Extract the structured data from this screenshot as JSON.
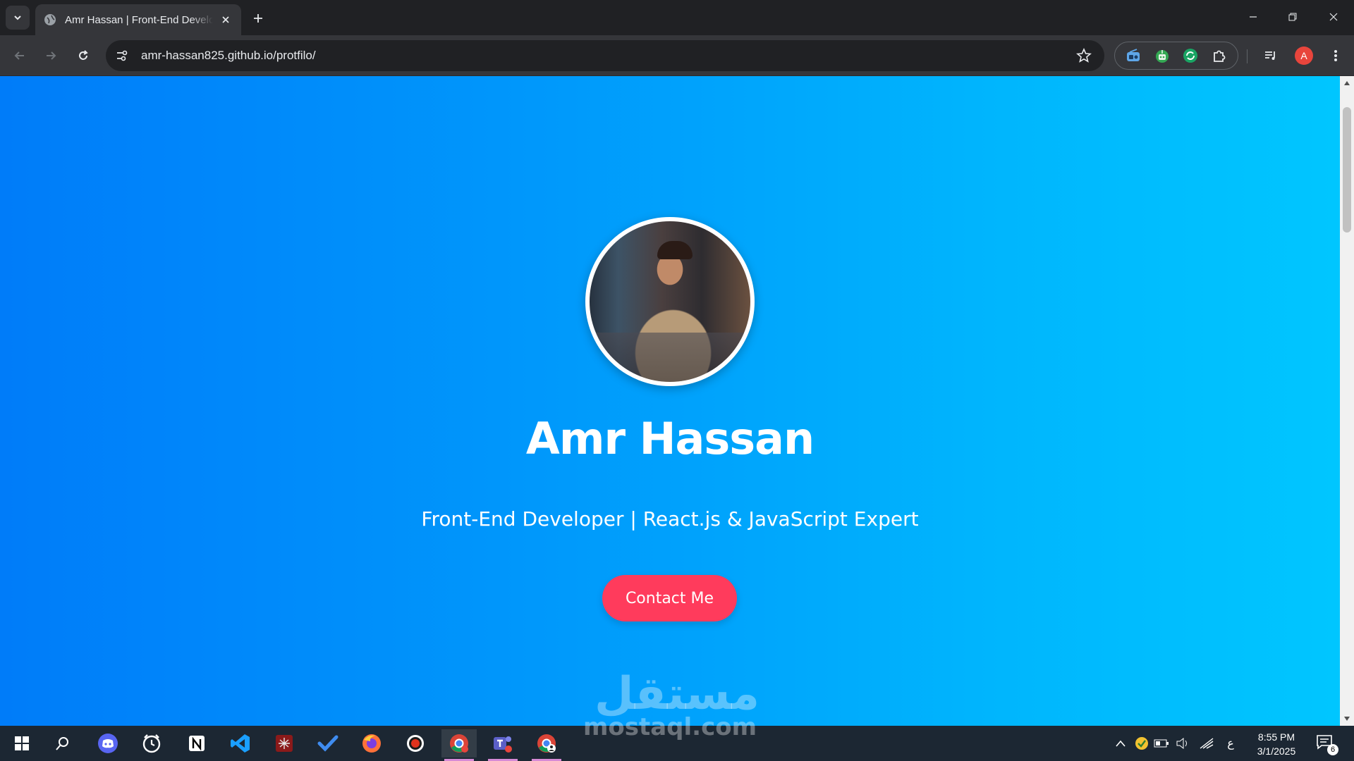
{
  "browser": {
    "tab_title": "Amr Hassan | Front-End Developer",
    "url": "amr-hassan825.github.io/protfilo/",
    "profile_initial": "A"
  },
  "hero": {
    "name": "Amr Hassan",
    "tagline": "Front-End Developer | React.js & JavaScript Expert",
    "cta_label": "Contact Me"
  },
  "watermark": {
    "arabic": "مستقل",
    "latin": "mostaql.com"
  },
  "colors": {
    "gradient_start": "#007cf9",
    "gradient_end": "#00c6ff",
    "cta": "#ff3b5c"
  },
  "taskbar": {
    "apps": [
      "windows-start",
      "search",
      "discord",
      "clock-app",
      "notion",
      "vscode",
      "spider-app",
      "todo",
      "firefox",
      "recorder",
      "chrome",
      "teams",
      "chrome-profile"
    ],
    "ime_indicator": "ع",
    "time": "8:55 PM",
    "date": "3/1/2025",
    "notification_count": "6"
  }
}
